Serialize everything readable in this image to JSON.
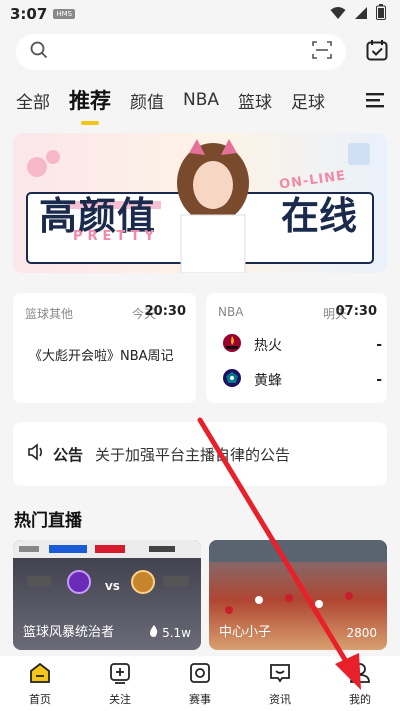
{
  "status_bar": {
    "time": "3:07",
    "badge": "HMS"
  },
  "search": {
    "placeholder": ""
  },
  "tabs": [
    {
      "label": "全部"
    },
    {
      "label": "推荐"
    },
    {
      "label": "颜值"
    },
    {
      "label": "NBA"
    },
    {
      "label": "篮球"
    },
    {
      "label": "足球"
    }
  ],
  "banner": {
    "title_left": "高颜值",
    "title_right": "在线",
    "overlay_en": "ON-LINE",
    "overlay_pretty": "PRETTY"
  },
  "matches": [
    {
      "league": "篮球其他",
      "day": "今天",
      "time": "20:30",
      "title": "《大彪开会啦》NBA周记"
    },
    {
      "league": "NBA",
      "day": "明天",
      "time": "07:30",
      "teams": [
        {
          "name": "热火",
          "score": "-"
        },
        {
          "name": "黄蜂",
          "score": "-"
        }
      ]
    }
  ],
  "notice": {
    "label": "公告",
    "text": "关于加强平台主播自律的公告"
  },
  "hot_live": {
    "title": "热门直播",
    "items": [
      {
        "name": "篮球风暴统治者",
        "count": "5.1w",
        "vs": "VS"
      },
      {
        "name": "中心小子",
        "count": "2800"
      }
    ]
  },
  "bottom_nav": [
    {
      "label": "首页"
    },
    {
      "label": "关注"
    },
    {
      "label": "赛事"
    },
    {
      "label": "资讯"
    },
    {
      "label": "我的"
    }
  ],
  "colors": {
    "accent": "#f5c518",
    "arrow": "#e8202a"
  }
}
